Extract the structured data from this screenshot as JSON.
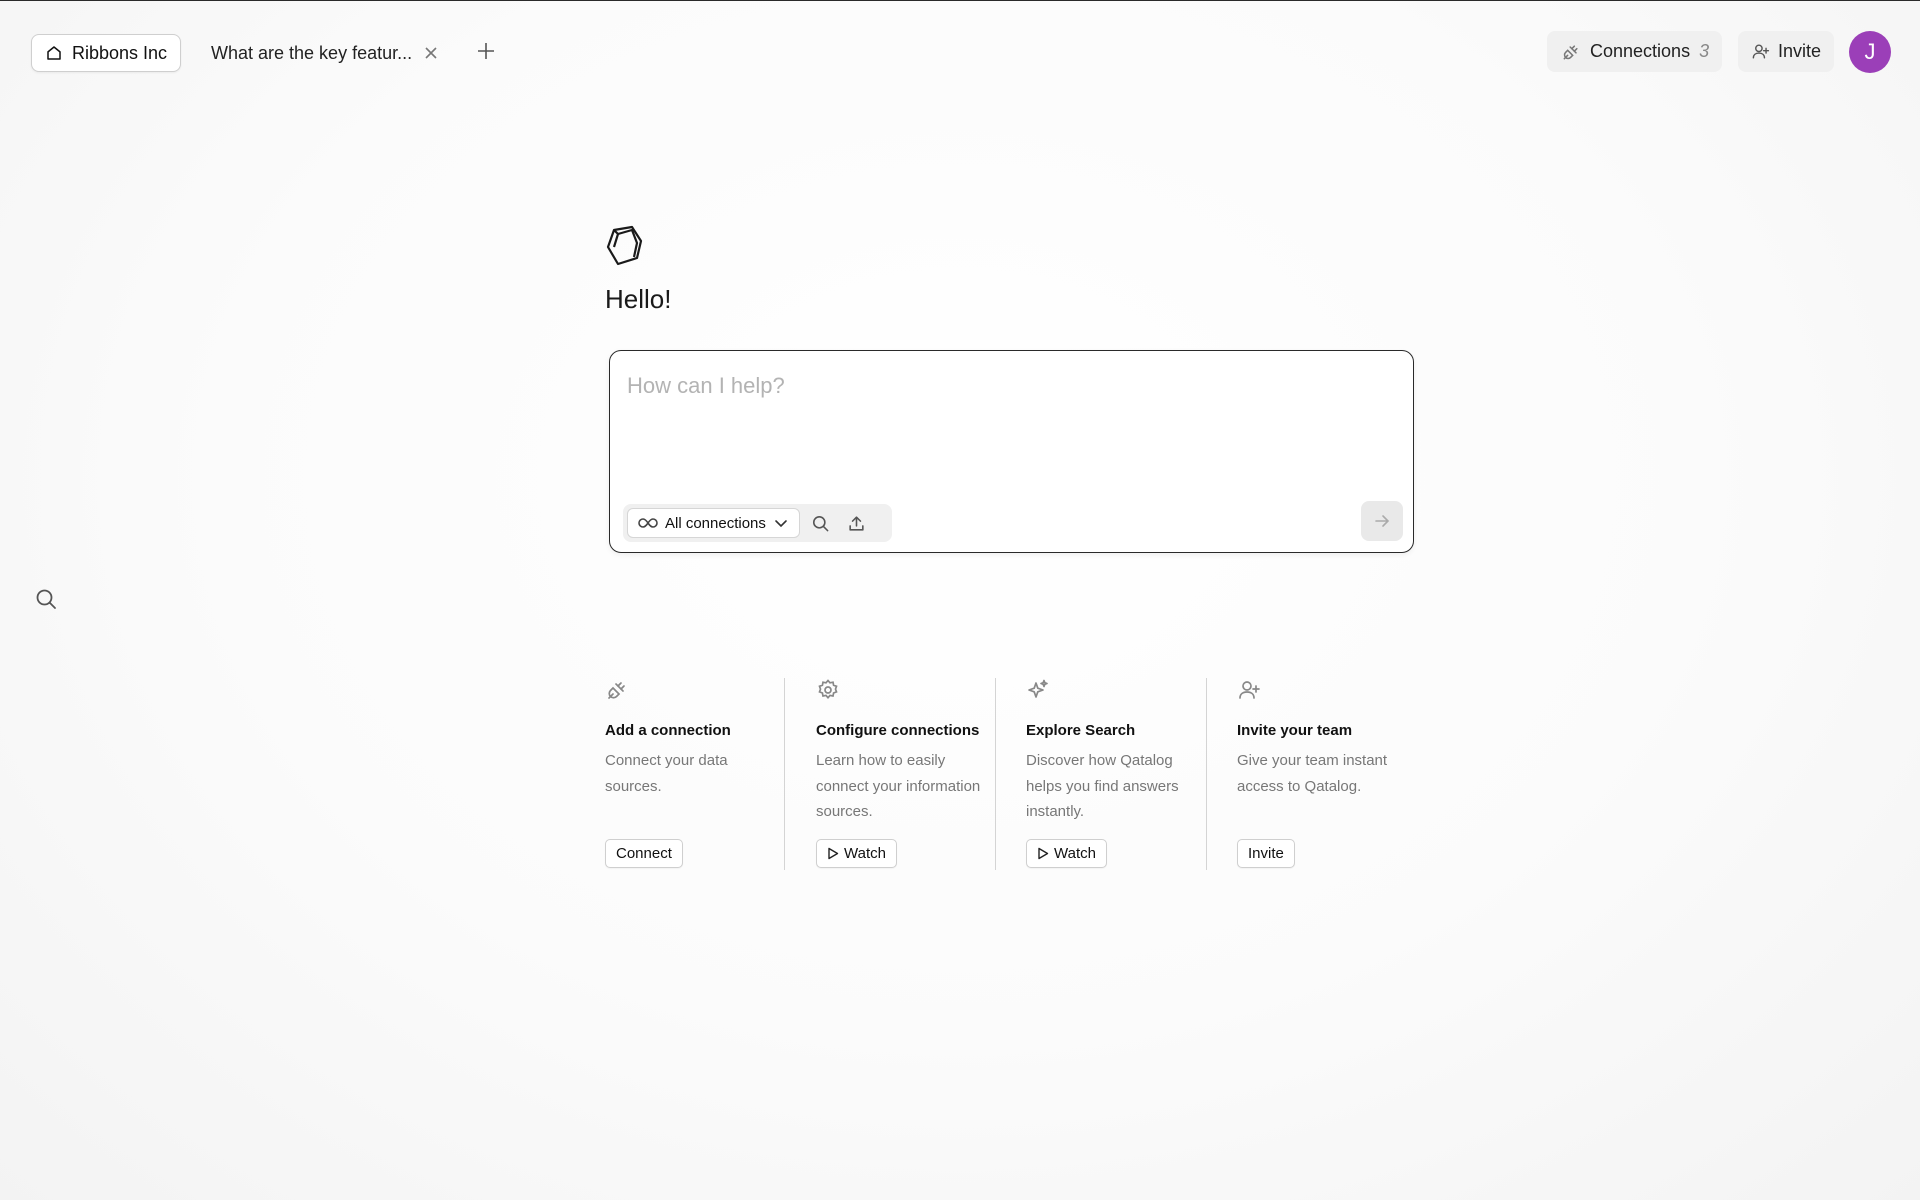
{
  "tabs": {
    "home_label": "Ribbons Inc",
    "doc_label": "What are the key featur...",
    "home_icon": "home-icon",
    "close_icon": "close-icon",
    "new_tab_icon": "plus-icon"
  },
  "header": {
    "connections_label": "Connections",
    "connections_count": "3",
    "invite_label": "Invite",
    "avatar_initial": "J",
    "avatar_color": "#9b3fb8"
  },
  "main": {
    "greeting": "Hello!"
  },
  "composer": {
    "placeholder": "How can I help?",
    "scope_label": "All connections"
  },
  "cards": [
    {
      "icon": "plug-icon",
      "title": "Add a connection",
      "description": "Connect your data sources.",
      "button": "Connect"
    },
    {
      "icon": "gear-icon",
      "title": "Configure connections",
      "description": "Learn how to easily connect your information sources.",
      "button": "Watch"
    },
    {
      "icon": "sparkle-icon",
      "title": "Explore Search",
      "description": "Discover how Qatalog helps you find answers instantly.",
      "button": "Watch"
    },
    {
      "icon": "user-plus-icon",
      "title": "Invite your team",
      "description": "Give your team instant access to Qatalog.",
      "button": "Invite"
    }
  ]
}
